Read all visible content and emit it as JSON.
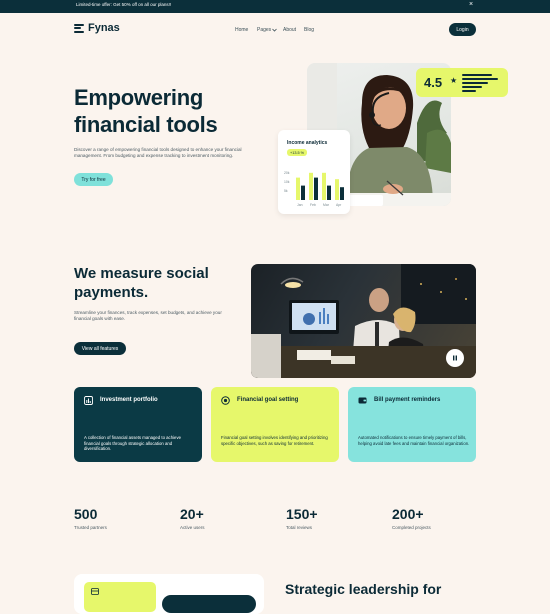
{
  "banner": {
    "text": "Limited-time offer: Get 50% off on all our plans!!",
    "close": "×"
  },
  "brand": {
    "name": "Fynas"
  },
  "nav": {
    "home": "Home",
    "pages": "Pages",
    "about": "About",
    "blog": "Blog",
    "login": "Login"
  },
  "hero": {
    "title_line1": "Empowering",
    "title_line2": "financial tools",
    "description": "Discover a range of empowering financial tools designed to enhance your financial management. From budgeting and expense tracking to investment monitoring.",
    "cta": "Try for free"
  },
  "rating": {
    "value": "4.5",
    "star": "★"
  },
  "analytics": {
    "title": "Income analytics",
    "badge": "+13.5 %",
    "y_ticks": [
      "20k",
      "10k",
      "5k"
    ],
    "chart_data": {
      "type": "bar",
      "categories": [
        "Jan",
        "Feb",
        "Mar",
        "Apr"
      ],
      "series": [
        {
          "values": [
            14,
            17,
            17,
            13
          ]
        },
        {
          "values": [
            9,
            14,
            9,
            8
          ]
        }
      ],
      "ylim": [
        0,
        20
      ]
    }
  },
  "section2": {
    "title_line1": "We measure social",
    "title_line2": "payments.",
    "description": "Streamline your finances, track expenses, set budgets, and achieve your financial goals with ease.",
    "cta": "View all features"
  },
  "features": [
    {
      "title": "Investment portfolio",
      "description": "A collection of financial assets managed to achieve financial goals through strategic allocation and diversification.",
      "bg": "#0b3a45",
      "fg": "#ffffff"
    },
    {
      "title": "Financial goal setting",
      "description": "Financial goal setting involves identifying and prioritizing specific objectives, such as saving for retirement.",
      "bg": "#e6f76b",
      "fg": "#0b2a36"
    },
    {
      "title": "Bill payment reminders",
      "description": "Automated notifications to ensure timely payment of bills, helping avoid late fees and maintain financial organization.",
      "bg": "#86e3dd",
      "fg": "#0b2a36"
    }
  ],
  "stats": [
    {
      "value": "500",
      "label": "Trusted partners"
    },
    {
      "value": "20+",
      "label": "Active users"
    },
    {
      "value": "150+",
      "label": "Total reviews"
    },
    {
      "value": "200+",
      "label": "Completed projects"
    }
  ],
  "bottom": {
    "title": "Strategic leadership for"
  },
  "colors": {
    "dark": "#0b2f3a",
    "lime": "#e6f76b",
    "teal": "#7fe1da",
    "bg": "#fbf4ee"
  }
}
